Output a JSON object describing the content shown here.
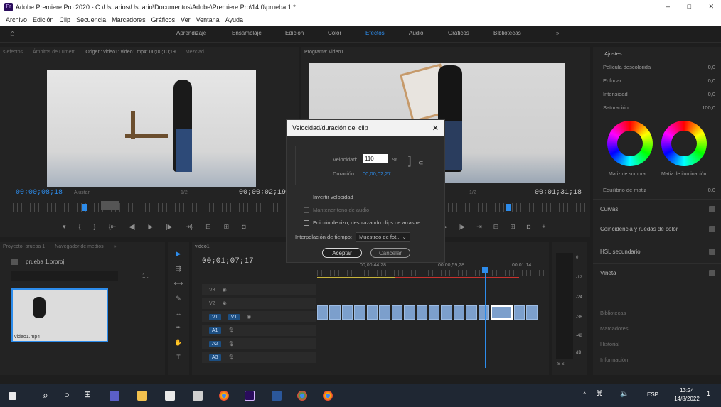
{
  "window": {
    "app_badge": "Pr",
    "title": "Adobe Premiere Pro 2020 - C:\\Usuarios\\Usuario\\Documentos\\Adobe\\Premiere Pro\\14.0\\prueba 1 *",
    "controls": [
      "–",
      "□",
      "✕"
    ]
  },
  "menu": [
    "Archivo",
    "Edición",
    "Clip",
    "Secuencia",
    "Marcadores",
    "Gráficos",
    "Ver",
    "Ventana",
    "Ayuda"
  ],
  "workspaces": [
    "Aprendizaje",
    "Ensamblaje",
    "Edición",
    "Color",
    "Efectos",
    "Audio",
    "Gráficos",
    "Bibliotecas",
    "»"
  ],
  "active_workspace": "Efectos",
  "source_panel": {
    "tabs": [
      "s efectos",
      "Ámbitos de Lumetri",
      "Origen: video1: video1.mp4: 00;00;10;19",
      "Mezclad"
    ],
    "timecode_left": "00;00;08;18",
    "fit": "Ajustar",
    "scale": "1/2",
    "timecode_right": "00;00;02;19"
  },
  "program_panel": {
    "tab": "Programa: video1",
    "scale": "1/2",
    "timecode_right": "00;01;31;18"
  },
  "project_panel": {
    "tabs": [
      "Proyecto: prueba 1",
      "Navegador de medios",
      "»"
    ],
    "file": "prueba 1.prproj",
    "count": "1..",
    "thumb_label": "video1.mp4"
  },
  "timeline": {
    "tab": "video1",
    "timecode": "00;01;07;17",
    "ruler_labels": [
      "00;00;44;28",
      "00;00;59;28",
      "00;01;14"
    ],
    "tracks": [
      {
        "name": "V3",
        "patch": ""
      },
      {
        "name": "V2",
        "patch": ""
      },
      {
        "name": "V1",
        "patch": "V1"
      },
      {
        "name": "A1",
        "patch": ""
      },
      {
        "name": "A2",
        "patch": ""
      },
      {
        "name": "A3",
        "patch": ""
      }
    ]
  },
  "meter": {
    "labels": [
      "0",
      "-12",
      "-24",
      "-36",
      "-48",
      "dB"
    ],
    "buttons": "S S"
  },
  "lumetri": {
    "section": "Ajustes",
    "items": [
      {
        "label": "Película descolorida",
        "value": "0,0"
      },
      {
        "label": "Enfocar",
        "value": "0,0"
      },
      {
        "label": "Intensidad",
        "value": "0,0"
      },
      {
        "label": "Saturación",
        "value": "100,0"
      }
    ],
    "wheel_labels": [
      "Matiz de sombra",
      "Matiz de iluminación"
    ],
    "balance": {
      "label": "Equilibrio de matiz",
      "value": "0,0"
    },
    "sections": [
      "Curvas",
      "Coincidencia y ruedas de color",
      "HSL secundario",
      "Viñeta"
    ],
    "collapsed": [
      "Bibliotecas",
      "Marcadores",
      "Historial",
      "Información"
    ]
  },
  "dialog": {
    "title": "Velocidad/duración del clip",
    "speed_label": "Velocidad:",
    "speed_value": "110",
    "speed_unit": "%",
    "duration_label": "Duración:",
    "duration_value": "00;00;02;27",
    "options": [
      {
        "label": "Invertir velocidad",
        "enabled": true
      },
      {
        "label": "Mantener tono de audio",
        "enabled": false
      },
      {
        "label": "Edición de rizo, desplazando clips de arrastre",
        "enabled": true
      }
    ],
    "interp_label": "Interpolación de tiempo:",
    "interp_value": "Muestreo de fot...",
    "ok": "Aceptar",
    "cancel": "Cancelar"
  },
  "taskbar": {
    "tray": [
      "^",
      "ESP"
    ],
    "time": "13:24",
    "date": "14/8/2022",
    "notif": "1"
  },
  "colors": {
    "accent": "#2d8ceb",
    "premiere": "#2a0c5c",
    "premiere_text": "#d7b6ff"
  }
}
